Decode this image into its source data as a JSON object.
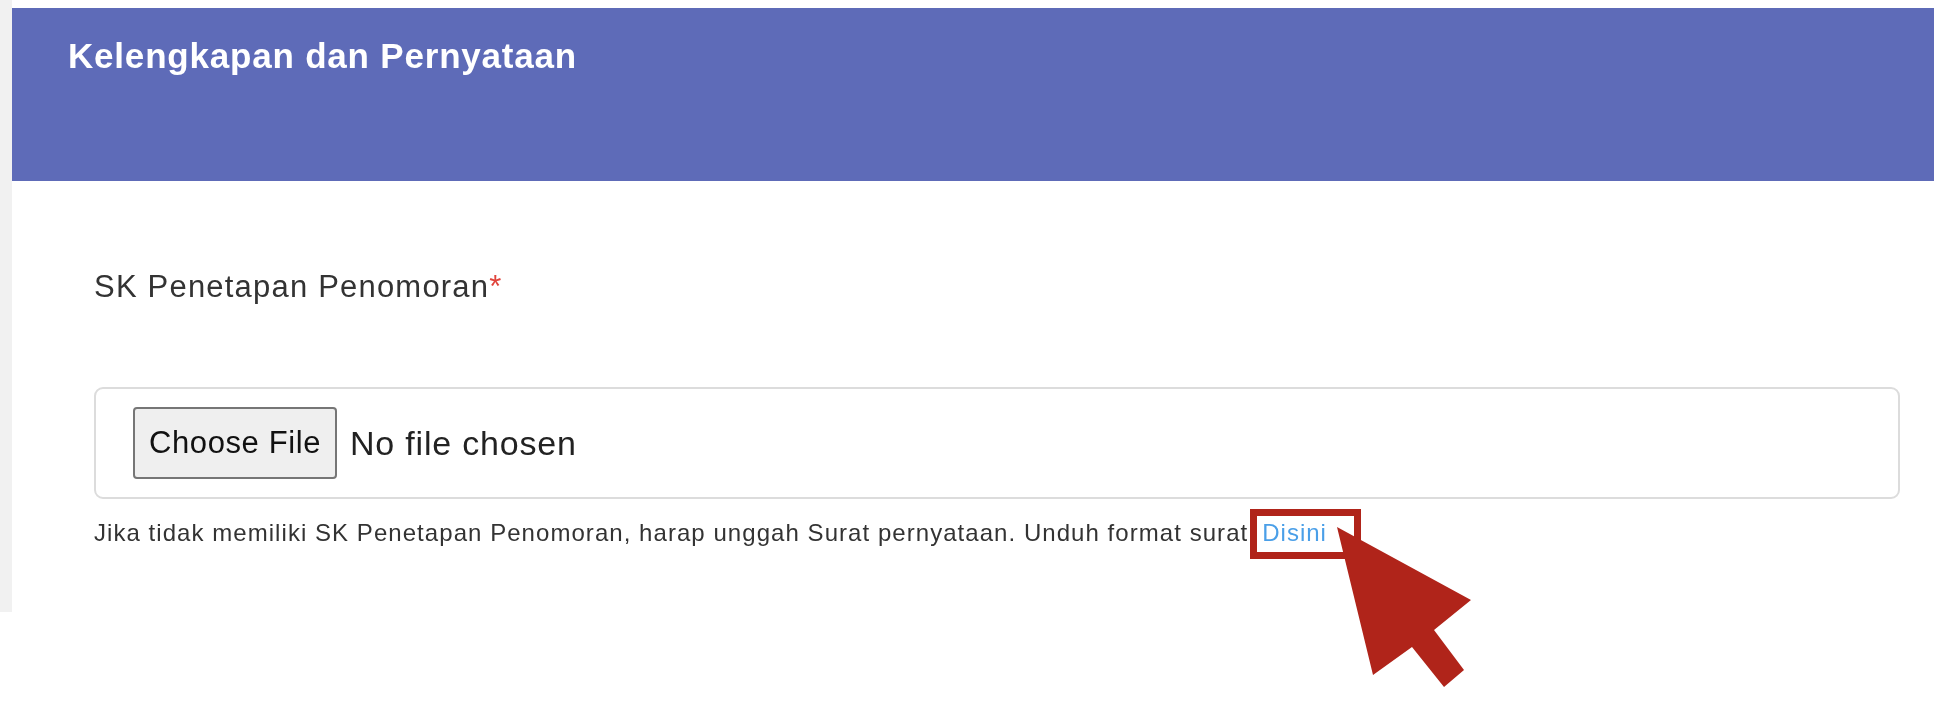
{
  "header": {
    "title": "Kelengkapan dan Pernyataan"
  },
  "field": {
    "label": "SK Penetapan Penomoran",
    "required": true,
    "required_mark": "*",
    "button": "Choose File",
    "status": "No file chosen"
  },
  "help": {
    "text": "Jika tidak memiliki SK Penetapan Penomoran, harap unggah Surat pernyataan. Unduh format surat",
    "link": "Disini",
    "highlighted": true
  }
}
